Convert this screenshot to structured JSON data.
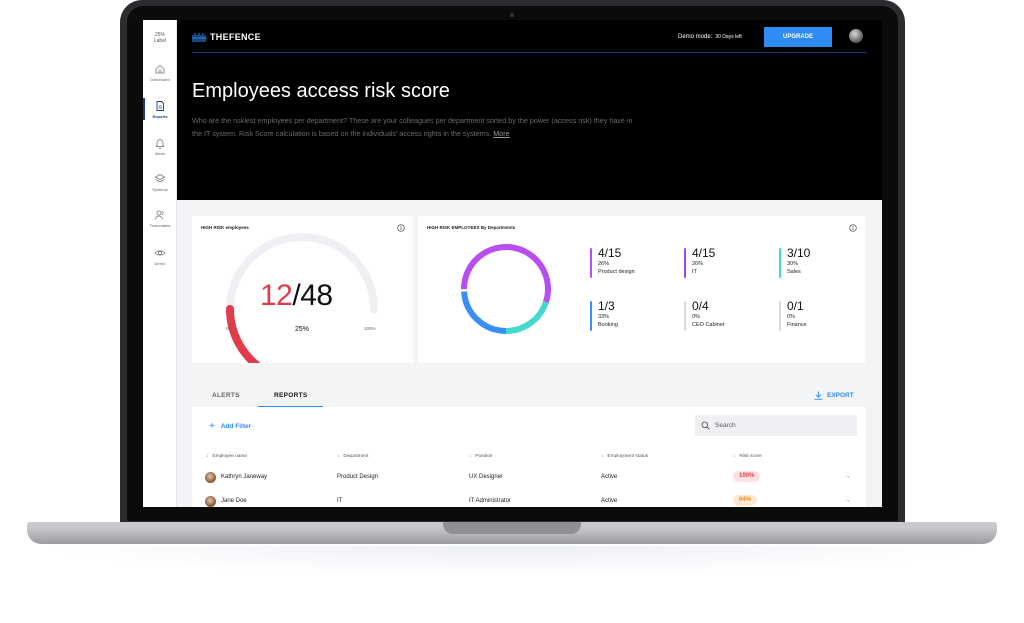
{
  "sidebar": {
    "license_pct": "25%",
    "license_label": "Label",
    "items": [
      {
        "label": "Dashboard",
        "icon": "home-icon"
      },
      {
        "label": "Reports",
        "icon": "document-icon",
        "active": true
      },
      {
        "label": "Alerts",
        "icon": "bell-icon"
      },
      {
        "label": "Systems",
        "icon": "layers-icon"
      },
      {
        "label": "Teammates",
        "icon": "users-icon"
      },
      {
        "label": "Demo",
        "icon": "eye-icon"
      }
    ]
  },
  "header": {
    "brand": "THEFENCE",
    "demo_label": "Demo mode:",
    "demo_days": "30 Days left",
    "upgrade_label": "UPGRADE",
    "title": "Employees access risk score",
    "description": "Who are the riskiest employees per department? These are your colleagues per department sorted by the power (access risk) they have in the IT system. Risk Score calculation is based on the individuals' access rights in the systems.",
    "more_link": "More"
  },
  "high_risk_card": {
    "title": "HIGH RISK employees",
    "high": "12",
    "total": "/48",
    "percent": "25%",
    "min_label": "0%",
    "max_label": "100%",
    "fraction": 0.25
  },
  "departments_card": {
    "title": "HIGH RISK EMPLOYEES By Departments",
    "departments": [
      {
        "ratio": "4/15",
        "pct": "26%",
        "name": "Product design",
        "color": "#b94ef0"
      },
      {
        "ratio": "4/15",
        "pct": "26%",
        "name": "IT",
        "color": "#9b46f2"
      },
      {
        "ratio": "3/10",
        "pct": "30%",
        "name": "Sales",
        "color": "#46d9d0"
      },
      {
        "ratio": "1/3",
        "pct": "33%",
        "name": "Booking",
        "color": "#3b8ef5"
      },
      {
        "ratio": "0/4",
        "pct": "0%",
        "name": "CEO Cabinet",
        "color": "#d9d9d9"
      },
      {
        "ratio": "0/1",
        "pct": "0%",
        "name": "Finance",
        "color": "#d9d9d9"
      }
    ]
  },
  "tabs": {
    "alerts": "ALERTS",
    "reports": "REPORTS",
    "export": "EXPORT"
  },
  "table": {
    "add_filter": "Add Filter",
    "search_placeholder": "Search",
    "columns": [
      "Employee name",
      "Department",
      "Position",
      "Employment status",
      "Risk score"
    ],
    "rows": [
      {
        "name": "Kathryn Janeway",
        "department": "Product Design",
        "position": "UX Designer",
        "status": "Active",
        "risk": "100%",
        "risk_bg": "#fde1e3",
        "risk_color": "#e23b4c"
      },
      {
        "name": "Jane Doe",
        "department": "IT",
        "position": "IT Administrator",
        "status": "Active",
        "risk": "64%",
        "risk_bg": "#ffe9d2",
        "risk_color": "#f08a24"
      }
    ]
  }
}
